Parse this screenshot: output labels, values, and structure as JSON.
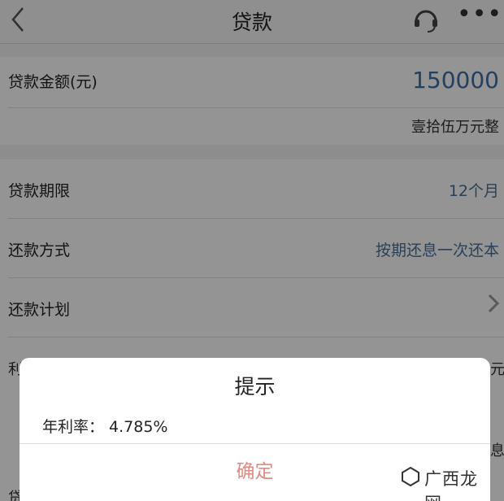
{
  "header": {
    "title": "贷款"
  },
  "loan_amount": {
    "label": "贷款金额(元)",
    "value": "150000",
    "value_in_words": "壹拾伍万元整"
  },
  "rows": [
    {
      "label": "贷款期限",
      "value": "12个月"
    },
    {
      "label": "还款方式",
      "value": "按期还息一次还本"
    },
    {
      "label": "还款计划",
      "value": ""
    }
  ],
  "partial_rows": {
    "row4_label": "利",
    "row4_value": "元",
    "row6_label": "贷",
    "row5_value": "息"
  },
  "dialog": {
    "title": "提示",
    "rate_text": "年利率： 4.785%",
    "ok_label": "确定"
  },
  "watermark": {
    "text": "广西龙网"
  },
  "colors": {
    "accent": "#4a6f95",
    "confirm": "#e08a84"
  }
}
